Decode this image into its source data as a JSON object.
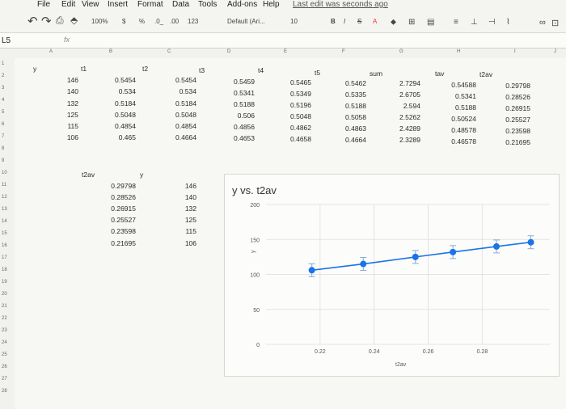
{
  "menu": [
    "File",
    "Edit",
    "View",
    "Insert",
    "Format",
    "Data",
    "Tools",
    "Add-ons",
    "Help"
  ],
  "last_edit": "Last edit was seconds ago",
  "toolbar": {
    "zoom": "100%",
    "currency": "$",
    "percent": "%",
    "decimal_less": ".0_",
    "decimal_more": ".00",
    "format_more": "123",
    "font_name": "Default (Ari...",
    "font_size": "10",
    "bold": "B",
    "italic": "I",
    "strike": "S",
    "text_color": "A"
  },
  "formula": {
    "name_box": "L5",
    "fx": "fx",
    "value": ""
  },
  "columns": [
    "A",
    "B",
    "C",
    "D",
    "E",
    "F",
    "G",
    "H",
    "I",
    "J"
  ],
  "rows": [
    "1",
    "2",
    "3",
    "4",
    "5",
    "6",
    "7",
    "8",
    "9",
    "10",
    "11",
    "12",
    "13",
    "14",
    "15",
    "16",
    "17",
    "18",
    "19",
    "20",
    "21",
    "22",
    "23",
    "24",
    "25",
    "26",
    "27",
    "28"
  ],
  "sheet": {
    "header": [
      "y",
      "t1",
      "t2",
      "t3",
      "t4",
      "t5",
      "sum",
      "tav",
      "t2av"
    ],
    "y": [
      "146",
      "140",
      "132",
      "125",
      "115",
      "106"
    ],
    "t1": [
      "0.5454",
      "0.534",
      "0.5184",
      "0.5048",
      "0.4854",
      "0.465"
    ],
    "t2": [
      "0.5454",
      "0.534",
      "0.5184",
      "0.5048",
      "0.4854",
      "0.4664"
    ],
    "t3": [
      "0.5459",
      "0.5341",
      "0.5188",
      "0.506",
      "0.4856",
      "0.4653"
    ],
    "t4": [
      "0.5465",
      "0.5349",
      "0.5196",
      "0.5048",
      "0.4862",
      "0.4658"
    ],
    "t5": [
      "0.5462",
      "0.5335",
      "0.5188",
      "0.5058",
      "0.4863",
      "0.4664"
    ],
    "sum": [
      "2.7294",
      "2.6705",
      "2.594",
      "2.5262",
      "2.4289",
      "2.3289"
    ],
    "tav": [
      "0.54588",
      "0.5341",
      "0.5188",
      "0.50524",
      "0.48578",
      "0.46578"
    ],
    "t2av": [
      "0.29798",
      "0.28526",
      "0.26915",
      "0.25527",
      "0.23598",
      "0.21695"
    ],
    "small_table": {
      "header_t2av": "t2av",
      "header_y": "y",
      "t2av": [
        "0.29798",
        "0.28526",
        "0.26915",
        "0.25527",
        "0.23598",
        "0.21695"
      ],
      "y": [
        "146",
        "140",
        "132",
        "125",
        "115",
        "106"
      ]
    }
  },
  "chart_data": {
    "type": "scatter",
    "title": "y vs. t2av",
    "xlabel": "t2av",
    "ylabel": "y",
    "xlim": [
      0.2,
      0.305
    ],
    "ylim": [
      0,
      200
    ],
    "x_ticks": [
      "0.22",
      "0.24",
      "0.26",
      "0.28"
    ],
    "y_ticks": [
      "0",
      "50",
      "100",
      "150",
      "200"
    ],
    "x": [
      0.21695,
      0.23598,
      0.25527,
      0.26915,
      0.28526,
      0.29798
    ],
    "y": [
      106,
      115,
      125,
      132,
      140,
      146
    ],
    "color": "#1a73e8",
    "grid": true
  }
}
